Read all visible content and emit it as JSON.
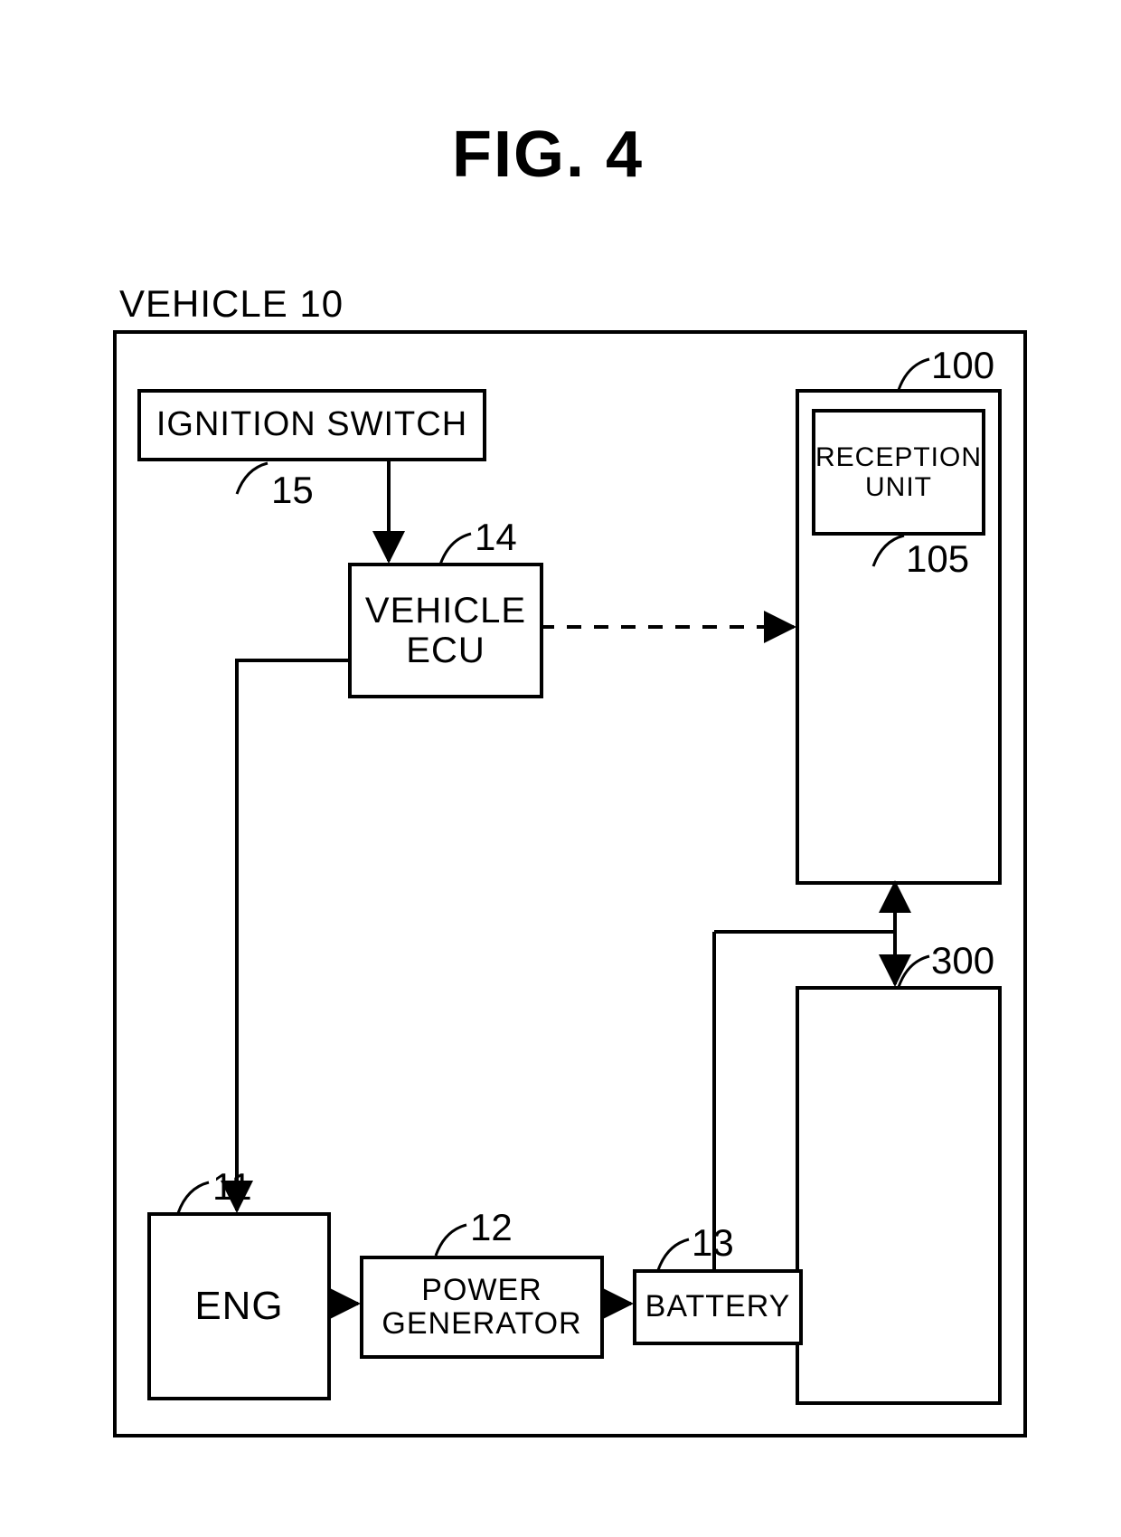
{
  "figure": {
    "title": "FIG. 4"
  },
  "vehicle": {
    "label": "VEHICLE 10"
  },
  "blocks": {
    "ignition": {
      "label": "IGNITION SWITCH",
      "ref": "15"
    },
    "ecu": {
      "label": "VEHICLE\nECU",
      "ref": "14"
    },
    "eng": {
      "label": "ENG",
      "ref": "11"
    },
    "pgen": {
      "label": "POWER\nGENERATOR",
      "ref": "12"
    },
    "batt": {
      "label": "BATTERY",
      "ref": "13"
    },
    "recv_container": {
      "ref": "100"
    },
    "recv": {
      "label": "RECEPTION\nUNIT",
      "ref": "105"
    },
    "block300": {
      "ref": "300"
    }
  },
  "chart_data": {
    "type": "block-diagram",
    "title": "FIG. 4",
    "container": {
      "id": "10",
      "label": "VEHICLE"
    },
    "nodes": [
      {
        "id": "15",
        "label": "IGNITION SWITCH"
      },
      {
        "id": "14",
        "label": "VEHICLE ECU"
      },
      {
        "id": "11",
        "label": "ENG"
      },
      {
        "id": "12",
        "label": "POWER GENERATOR"
      },
      {
        "id": "13",
        "label": "BATTERY"
      },
      {
        "id": "100",
        "label": ""
      },
      {
        "id": "105",
        "label": "RECEPTION UNIT",
        "parent": "100"
      },
      {
        "id": "300",
        "label": ""
      }
    ],
    "edges": [
      {
        "from": "15",
        "to": "14",
        "style": "solid",
        "arrow": "to"
      },
      {
        "from": "14",
        "to": "11",
        "style": "solid",
        "arrow": "to"
      },
      {
        "from": "14",
        "to": "105",
        "style": "dashed",
        "arrow": "to"
      },
      {
        "from": "11",
        "to": "12",
        "style": "solid",
        "arrow": "to"
      },
      {
        "from": "12",
        "to": "13",
        "style": "solid",
        "arrow": "to"
      },
      {
        "from": "13",
        "to": "100",
        "style": "solid",
        "arrow": "to"
      },
      {
        "from": "13",
        "to": "300",
        "style": "solid",
        "arrow": "to"
      }
    ]
  }
}
